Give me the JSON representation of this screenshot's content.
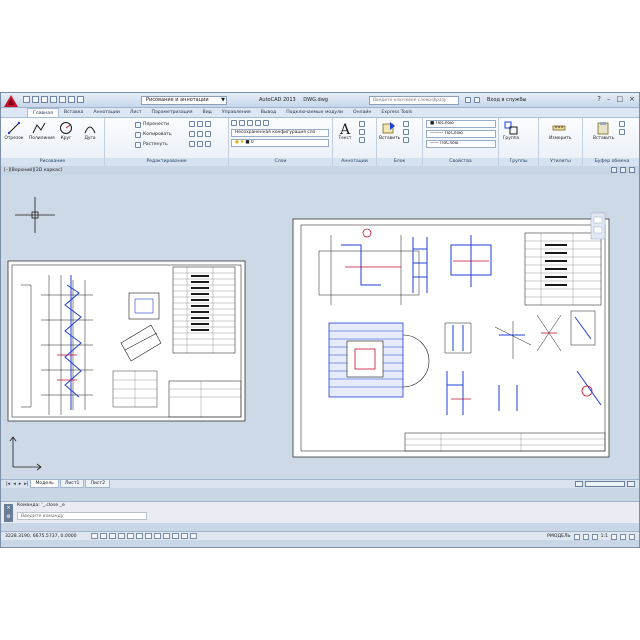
{
  "window": {
    "app_title": "AutoCAD 2013",
    "file_name": "DWG.dwg",
    "workspace": "Рисование и аннотации",
    "search_placeholder": "Введите ключевое слово/фразу",
    "sign_in": "Вход в службы"
  },
  "tabs": [
    {
      "label": "Главная",
      "active": true
    },
    {
      "label": "Вставка"
    },
    {
      "label": "Аннотации"
    },
    {
      "label": "Лист"
    },
    {
      "label": "Параметризация"
    },
    {
      "label": "Вид"
    },
    {
      "label": "Управление"
    },
    {
      "label": "Вывод"
    },
    {
      "label": "Подключаемые модули"
    },
    {
      "label": "Онлайн"
    },
    {
      "label": "Express Tools"
    }
  ],
  "ribbon": {
    "draw": {
      "title": "Рисование",
      "tools": [
        "Отрезок",
        "Полилиния",
        "Круг",
        "Дуга"
      ]
    },
    "modify": {
      "title": "Редактирование",
      "tools": [
        "Перенести",
        "Копировать",
        "Растянуть"
      ]
    },
    "layers": {
      "title": "Слои",
      "layer_state": "Несохраненная конфигурация сло",
      "current_layer": "0"
    },
    "annotations": {
      "title": "Аннотации",
      "tool": "Текст"
    },
    "block": {
      "title": "Блок",
      "tool": "Вставить"
    },
    "properties": {
      "title": "Свойства",
      "color": "ПоСлою",
      "linetype": "ПоСлою",
      "lineweight": "ПоСлою"
    },
    "groups": {
      "title": "Группы",
      "tool": "Группа"
    },
    "utilities": {
      "title": "Утилиты",
      "tool": "Измерить"
    },
    "clipboard": {
      "title": "Буфер обмена",
      "tool": "Вставить"
    }
  },
  "viewport": {
    "label": "[–][Верхний][2D каркас]"
  },
  "layout_tabs": [
    {
      "label": "Модель",
      "active": true
    },
    {
      "label": "Лист1"
    },
    {
      "label": "Лист2"
    }
  ],
  "command": {
    "history": "Команда: '_.close _e",
    "prompt": "Введите команду"
  },
  "status": {
    "coordinates": "3228.3190, 6675.5737, 0.0000",
    "model_label": "РМОДЕЛЬ",
    "scale": "1:1"
  },
  "colors": {
    "canvas_bg": "#cdd9e7",
    "ribbon_bg": "#f4f7fb",
    "drawing_line": "#1a1a1a",
    "drawing_accent_blue": "#1f3fd6",
    "drawing_accent_red": "#c8102e"
  }
}
